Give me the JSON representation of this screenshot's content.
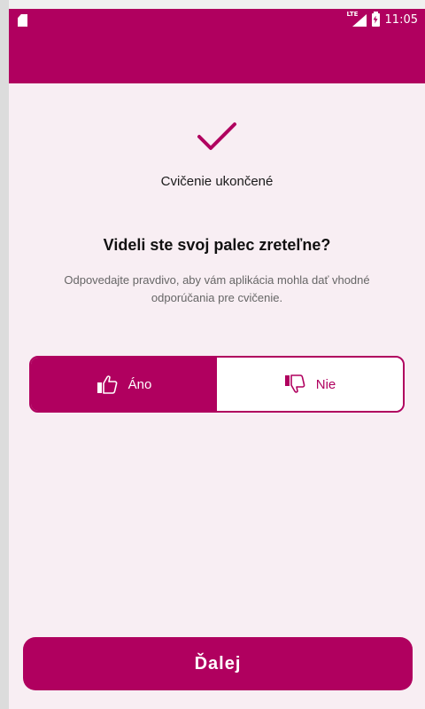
{
  "status_bar": {
    "network": "LTE",
    "time": "11:05"
  },
  "screen": {
    "subtitle": "Cvičenie ukončené",
    "question": "Videli ste svoj palec zreteľne?",
    "hint": "Odpovedajte pravdivo, aby vám aplikácia mohla dať vhodné odporúčania pre cvičenie."
  },
  "answer_toggle": {
    "yes_label": "Áno",
    "no_label": "Nie",
    "selected": "Áno"
  },
  "footer": {
    "next_label": "Ďalej"
  },
  "colors": {
    "primary": "#b0005f",
    "background": "#f8eef3"
  },
  "icons": [
    "sd-card-icon",
    "lte-signal-icon",
    "battery-charging-icon",
    "checkmark-icon",
    "thumbs-up-icon",
    "thumbs-down-icon"
  ]
}
